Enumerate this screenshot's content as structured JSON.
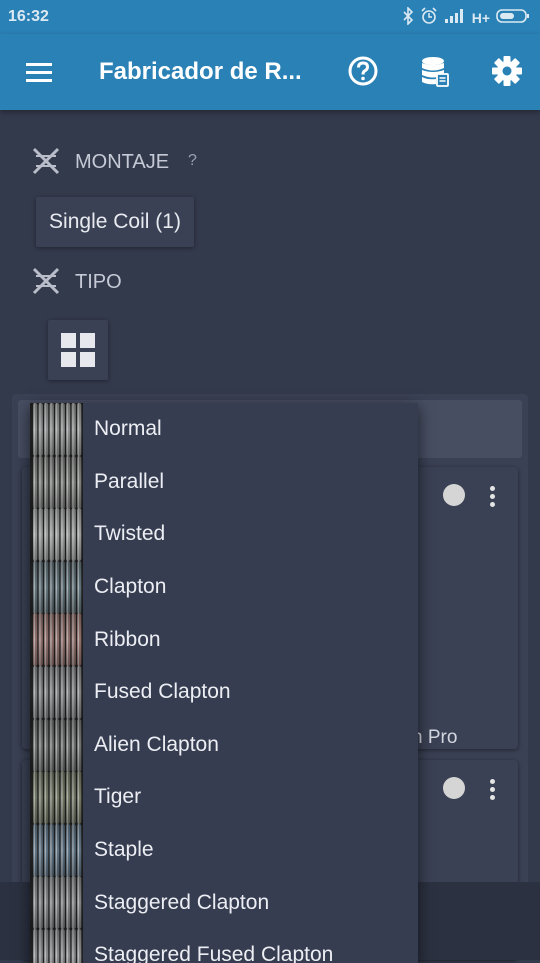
{
  "status_bar": {
    "time": "16:32",
    "network": "H+",
    "icons": [
      "bluetooth-icon",
      "alarm-icon",
      "signal-icon",
      "battery-icon"
    ]
  },
  "app_bar": {
    "title": "Fabricador de R...",
    "color": "#2a81b5",
    "icons": [
      "menu-icon",
      "help-icon",
      "database-icon",
      "settings-icon"
    ]
  },
  "sections": {
    "montaje": {
      "label": "MONTAJE",
      "help": "?",
      "value": "Single Coil (1)"
    },
    "tipo": {
      "label": "TIPO"
    }
  },
  "card1": {
    "text": "n Pro"
  },
  "dropdown": {
    "items": [
      {
        "label": "Normal",
        "thumb": "#8c8f8f"
      },
      {
        "label": "Parallel",
        "thumb": "#7c7e7c"
      },
      {
        "label": "Twisted",
        "thumb": "#9a9b9b"
      },
      {
        "label": "Clapton",
        "thumb": "#5f7077"
      },
      {
        "label": "Ribbon",
        "thumb": "#8e6e6a"
      },
      {
        "label": "Fused Clapton",
        "thumb": "#7f8183"
      },
      {
        "label": "Alien Clapton",
        "thumb": "#6c7170"
      },
      {
        "label": "Tiger",
        "thumb": "#6f7563"
      },
      {
        "label": "Staple",
        "thumb": "#5c7080"
      },
      {
        "label": "Staggered Clapton",
        "thumb": "#7d8183"
      },
      {
        "label": "Staggered Fused Clapton",
        "thumb": "#858789"
      }
    ]
  }
}
